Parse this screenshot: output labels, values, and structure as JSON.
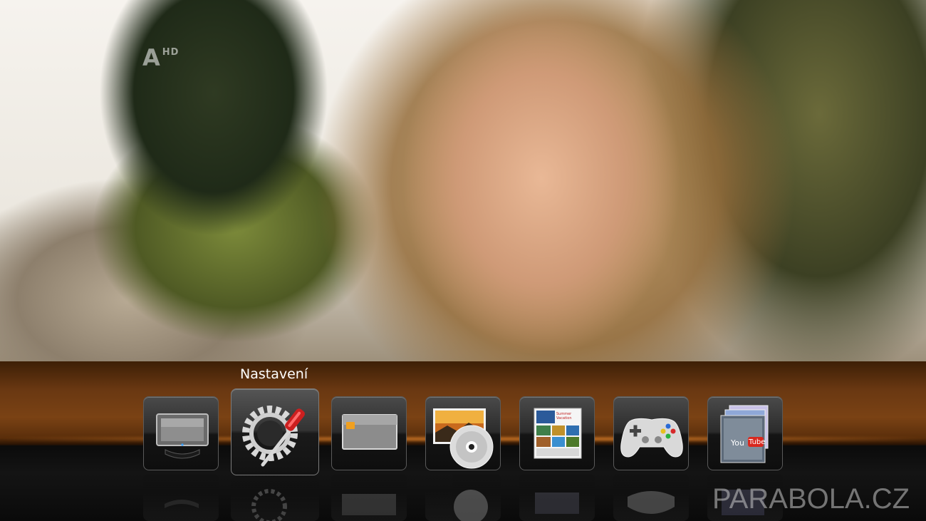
{
  "channel": {
    "logo_letter": "A",
    "logo_hd": "HD"
  },
  "menu": {
    "selected_label": "Nastavení",
    "items": [
      {
        "icon": "tv-icon"
      },
      {
        "icon": "settings-tools-icon"
      },
      {
        "icon": "card-icon"
      },
      {
        "icon": "photo-disc-icon"
      },
      {
        "icon": "photo-album-icon"
      },
      {
        "icon": "gamepad-icon"
      },
      {
        "icon": "youtube-icon"
      }
    ]
  },
  "album": {
    "caption": "Summer Vacation"
  },
  "youtube": {
    "you": "You",
    "tube": "Tube"
  },
  "watermark": {
    "text": "PARABOLA.CZ"
  },
  "colors": {
    "accent_orange": "#ff9632",
    "bar_brown": "#7a4214"
  }
}
